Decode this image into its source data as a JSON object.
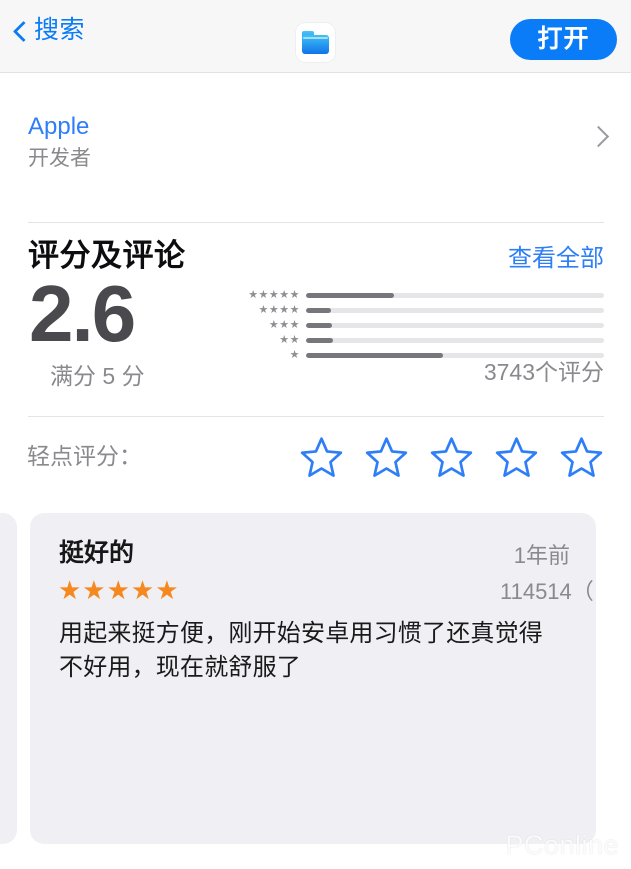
{
  "navbar": {
    "back_label": "搜索",
    "back_icon": "chevron-left-icon",
    "app_icon": "folder-app-icon",
    "open_button": "打开"
  },
  "developer": {
    "name": "Apple",
    "role": "开发者",
    "chevron_icon": "chevron-right-icon"
  },
  "ratings": {
    "section_title": "评分及评论",
    "see_all": "查看全部",
    "score": "2.6",
    "score_caption": "满分 5 分",
    "count_label": "3743个评分",
    "accent_color": "#0a7cf7",
    "bar_fill_color": "#76767c",
    "bar_track_color": "#e6e6e8"
  },
  "chart_data": {
    "type": "bar",
    "title": "评分分布",
    "orientation": "horizontal",
    "categories": [
      "★★★★★",
      "★★★★",
      "★★★",
      "★★",
      "★"
    ],
    "values": [
      29.5,
      8.3,
      8.6,
      9.0,
      46.0
    ],
    "ylabel": "",
    "xlabel": "",
    "xlim": [
      0,
      100
    ],
    "grid": false,
    "legend": false,
    "total_label": "3743个评分",
    "average": 2.6,
    "max_rating": 5
  },
  "rate_row": {
    "label": "轻点评分：",
    "stars": [
      {
        "icon": "star-outline-icon",
        "value": 1
      },
      {
        "icon": "star-outline-icon",
        "value": 2
      },
      {
        "icon": "star-outline-icon",
        "value": 3
      },
      {
        "icon": "star-outline-icon",
        "value": 4
      },
      {
        "icon": "star-outline-icon",
        "value": 5
      }
    ],
    "star_color": "#2d7ef7"
  },
  "review": {
    "title": "挺好的",
    "date": "1年前",
    "author": "114514（",
    "stars": "★★★★★",
    "star_color": "#f5881f",
    "body": "用起来挺方便，刚开始安卓用习惯了还真觉得不好用，现在就舒服了"
  },
  "watermark": "PConline"
}
